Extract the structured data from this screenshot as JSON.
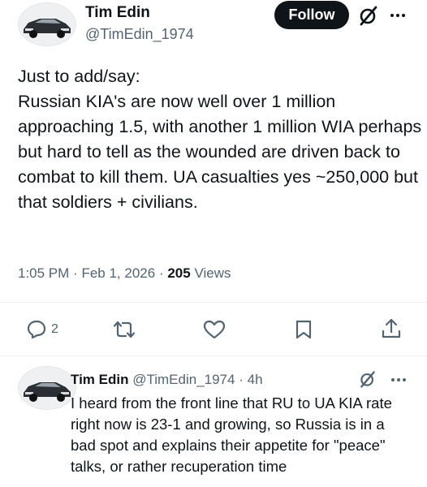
{
  "tweet": {
    "author": {
      "name": "Tim Edin",
      "handle": "@TimEdin_1974"
    },
    "follow_label": "Follow",
    "text": "Just to add/say:\nRussian KIA's are now well over 1 million approaching 1.5, with another 1 million WIA perhaps but hard to tell as the wounded are driven back to combat to kill them. UA casualties yes ~250,000 but that soldiers + civilians.",
    "time": "1:05 PM",
    "date": "Feb 1, 2026",
    "views_count": "205",
    "views_label": "Views",
    "reply_count": "2",
    "icons": {
      "grok": "grok-slash-icon",
      "more": "more-dots-icon",
      "reply": "reply-icon",
      "retweet": "retweet-icon",
      "like": "heart-icon",
      "bookmark": "bookmark-icon",
      "share": "share-icon"
    }
  },
  "reply": {
    "author": {
      "name": "Tim Edin",
      "handle": "@TimEdin_1974"
    },
    "age": "4h",
    "text": "I heard from the front line that RU to UA KIA rate right now is 23-1 and growing, so Russia is in a bad spot and explains their appetite for \"peace\" talks, or rather recuperation time"
  },
  "colors": {
    "text": "#0f1419",
    "secondary": "#536471",
    "divider": "#eff3f4",
    "follow_bg": "#0f1419"
  }
}
